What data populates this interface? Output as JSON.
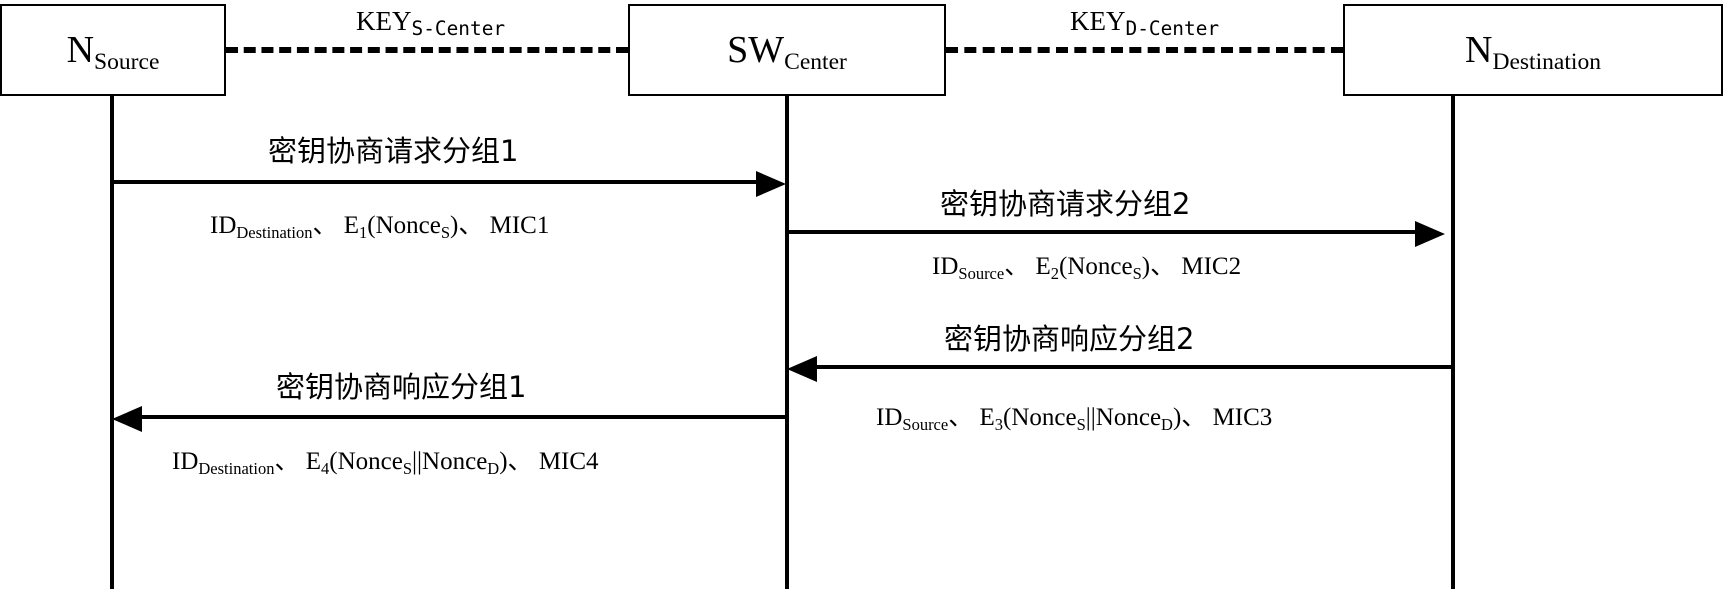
{
  "diagram": {
    "type": "sequence-diagram",
    "title": "",
    "nodes": [
      {
        "id": "source",
        "base": "N",
        "sub": "Source"
      },
      {
        "id": "center",
        "base": "SW",
        "sub": "Center"
      },
      {
        "id": "destination",
        "base": "N",
        "sub": "Destination"
      }
    ],
    "key_links": [
      {
        "id": "left",
        "base": "KEY",
        "sub": "S-Center",
        "style": "dashed"
      },
      {
        "id": "right",
        "base": "KEY",
        "sub": "D-Center",
        "style": "dashed"
      }
    ],
    "messages": [
      {
        "id": "msg1",
        "from": "source",
        "to": "center",
        "direction": "right",
        "title": "密钥协商请求分组1",
        "detail_parts": [
          {
            "base": "ID",
            "sub": "Destination"
          },
          {
            "sep": "、"
          },
          {
            "base": "E",
            "sub": "1",
            "arg_pre": "(Nonce",
            "arg_sub": "S",
            "arg_post": ")"
          },
          {
            "sep": "、"
          },
          {
            "base": "MIC1"
          }
        ],
        "detail_text": "ID_Destination、 E1(Nonce_S)、 MIC1"
      },
      {
        "id": "msg2",
        "from": "center",
        "to": "destination",
        "direction": "right",
        "title": "密钥协商请求分组2",
        "detail_parts": [
          {
            "base": "ID",
            "sub": "Source"
          },
          {
            "sep": "、"
          },
          {
            "base": "E",
            "sub": "2",
            "arg_pre": "(Nonce",
            "arg_sub": "S",
            "arg_post": ")"
          },
          {
            "sep": "、"
          },
          {
            "base": "MIC2"
          }
        ],
        "detail_text": "ID_Source、 E2(Nonce_S)、 MIC2"
      },
      {
        "id": "msg3",
        "from": "destination",
        "to": "center",
        "direction": "left",
        "title": "密钥协商响应分组2",
        "detail_parts": [
          {
            "base": "ID",
            "sub": "Source"
          },
          {
            "sep": "、"
          },
          {
            "base": "E",
            "sub": "3",
            "arg_pre": "(Nonce",
            "arg_sub": "S",
            "arg_mid": "||Nonce",
            "arg_sub2": "D",
            "arg_post": ")"
          },
          {
            "sep": "、"
          },
          {
            "base": "MIC3"
          }
        ],
        "detail_text": "ID_Source、 E3(Nonce_S||Nonce_D)、 MIC3"
      },
      {
        "id": "msg4",
        "from": "center",
        "to": "source",
        "direction": "left",
        "title": "密钥协商响应分组1",
        "detail_parts": [
          {
            "base": "ID",
            "sub": "Destination"
          },
          {
            "sep": "、"
          },
          {
            "base": "E",
            "sub": "4",
            "arg_pre": "(Nonce",
            "arg_sub": "S",
            "arg_mid": "||Nonce",
            "arg_sub2": "D",
            "arg_post": ")"
          },
          {
            "sep": "、"
          },
          {
            "base": "MIC4"
          }
        ],
        "detail_text": "ID_Destination、 E4(Nonce_S||Nonce_D)、 MIC4"
      }
    ],
    "colors": {
      "line": "#000000",
      "background": "#ffffff",
      "text": "#000000"
    }
  },
  "nodes": {
    "source": {
      "base": "N",
      "sub": "Source"
    },
    "center": {
      "base": "SW",
      "sub": "Center"
    },
    "destination": {
      "base": "N",
      "sub": "Destination"
    }
  },
  "key_links": {
    "left": {
      "base": "KEY",
      "sub": "S-Center"
    },
    "right": {
      "base": "KEY",
      "sub": "D-Center"
    }
  },
  "msg1": {
    "title": "密钥协商请求分组1",
    "id_base": "ID",
    "id_sub": "Destination",
    "sep1": "、",
    "sep2": "、",
    "e_base": "E",
    "e_sub": "1",
    "arg_open": "(Nonce",
    "arg_sub": "S",
    "arg_close": ")",
    "mic": "MIC1"
  },
  "msg2": {
    "title": "密钥协商请求分组2",
    "id_base": "ID",
    "id_sub": "Source",
    "sep1": "、",
    "sep2": "、",
    "e_base": "E",
    "e_sub": "2",
    "arg_open": "(Nonce",
    "arg_sub": "S",
    "arg_close": ")",
    "mic": "MIC2"
  },
  "msg3": {
    "title": "密钥协商响应分组2",
    "id_base": "ID",
    "id_sub": "Source",
    "sep1": "、",
    "sep2": "、",
    "e_base": "E",
    "e_sub": "3",
    "arg_open": "(Nonce",
    "arg_sub": "S",
    "arg_mid": "||Nonce",
    "arg_sub2": "D",
    "arg_close": ")",
    "mic": "MIC3"
  },
  "msg4": {
    "title": "密钥协商响应分组1",
    "id_base": "ID",
    "id_sub": "Destination",
    "sep1": "、",
    "sep2": "、",
    "e_base": "E",
    "e_sub": "4",
    "arg_open": "(Nonce",
    "arg_sub": "S",
    "arg_mid": "||Nonce",
    "arg_sub2": "D",
    "arg_close": ")",
    "mic": "MIC4"
  }
}
